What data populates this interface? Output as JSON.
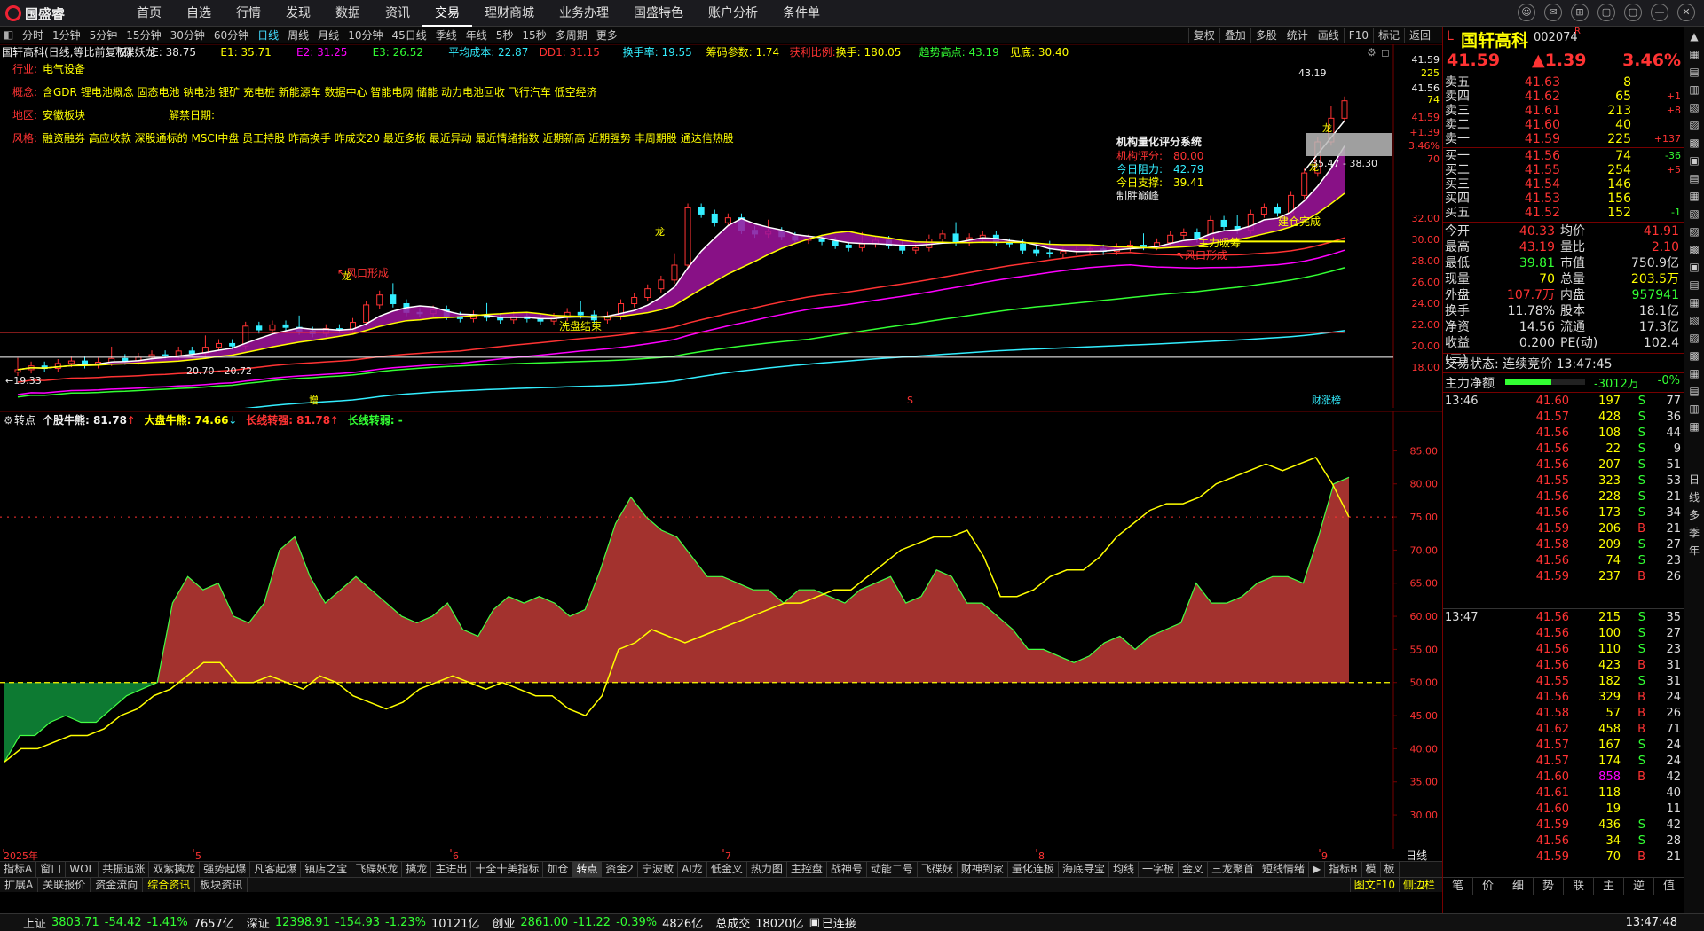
{
  "app": {
    "logo": "国盛睿",
    "menu": [
      "首页",
      "自选",
      "行情",
      "发现",
      "数据",
      "资讯",
      "交易",
      "理财商城",
      "业务办理",
      "国盛特色",
      "账户分析",
      "条件单"
    ],
    "active_menu": "交易",
    "window_controls": [
      "☺",
      "✉",
      "⊞",
      "▢",
      "▢",
      "—",
      "✕"
    ]
  },
  "period": {
    "items": [
      "分时",
      "1分钟",
      "5分钟",
      "15分钟",
      "30分钟",
      "60分钟",
      "日线",
      "周线",
      "月线",
      "10分钟",
      "45日线",
      "季线",
      "年线",
      "5秒",
      "15秒",
      "多周期",
      "更多"
    ],
    "selected": "日线",
    "tools": [
      "复权",
      "叠加",
      "多股",
      "统计",
      "画线",
      "F10",
      "标记",
      "返回"
    ]
  },
  "main": {
    "header": [
      {
        "t": "国轩高科(日线,等比前复权)",
        "c": "#eee"
      },
      {
        "t": "飞碟妖龙",
        "c": "#eee"
      },
      {
        "t": "E: 38.75",
        "c": "#eee"
      },
      {
        "t": "E1: 35.71",
        "c": "#ff0"
      },
      {
        "t": "E2: 31.25",
        "c": "#f0f"
      },
      {
        "t": "E3: 26.52",
        "c": "#3f3"
      },
      {
        "t": "平均成本: 22.87",
        "c": "#3ef"
      },
      {
        "t": "DD1: 31.15",
        "c": "#f33"
      },
      {
        "t": "换手率: 19.55",
        "c": "#3ef"
      },
      {
        "t": "筹码参数: 1.74",
        "c": "#ff0"
      },
      {
        "t": "获利比例:",
        "c": "#f33"
      },
      {
        "t": "换手: 180.05",
        "c": "#ff0"
      },
      {
        "t": "趋势高点: 43.19",
        "c": "#3f3"
      },
      {
        "t": "见底: 30.40",
        "c": "#ff0"
      }
    ],
    "info": [
      {
        "label": "行业:",
        "text": "电气设备"
      },
      {
        "label": "概念:",
        "text": "含GDR 锂电池概念 固态电池 钠电池 锂矿 充电桩 新能源车 数据中心 智能电网 储能 动力电池回收 飞行汽车 低空经济"
      },
      {
        "label": "地区:",
        "text": "安徽板块",
        "extra_label": "解禁日期:",
        "extra_text": ""
      },
      {
        "label": "风格:",
        "text": "融资融券 高应收款 深股通标的 MSCI中盘 员工持股 昨高换手 昨成交20 最近多板 最近异动 最近情绪指数 近期新高 近期强势 丰周期股 通达信热股"
      }
    ],
    "score": {
      "title": "机构量化评分系统",
      "rows": [
        {
          "k": "机构评分:",
          "v": "80.00",
          "c": "#f33"
        },
        {
          "k": "今日阻力:",
          "v": "42.79",
          "c": "#3ef"
        },
        {
          "k": "今日支撑:",
          "v": "39.41",
          "c": "#ff0"
        }
      ],
      "note": "制胜巅峰"
    },
    "labels": {
      "feng1": "风口形成",
      "xipan": "洗盘结束",
      "feng2": "风口形成",
      "zhuli": "主力吸筹",
      "jiancang": "建仓完成",
      "long": "龙",
      "zeng": "增",
      "s": "S",
      "caifu": "财涨榜"
    },
    "price_marks": {
      "high": "43.19",
      "low_pair": "35.47 - 38.30",
      "left_low": "19.33",
      "pair": "20.70 - 20.72"
    },
    "yaxis": [
      "41.59",
      "225",
      "41.56",
      "74",
      "41.59",
      "+1.39",
      "3.46%",
      "70",
      "32.00",
      "30.00",
      "28.00",
      "26.00",
      "24.00",
      "22.00",
      "20.00",
      "18.00"
    ]
  },
  "ind": {
    "title": "转点",
    "items": [
      {
        "t": "个股牛熊: 81.78",
        "c": "#eee",
        "arrow": "↑",
        "ac": "#f33"
      },
      {
        "t": "大盘牛熊: 74.66",
        "c": "#ff0",
        "arrow": "↓",
        "ac": "#3ef"
      },
      {
        "t": "长线转强: 81.78",
        "c": "#f33",
        "arrow": "↑",
        "ac": "#f33"
      },
      {
        "t": "长线转弱: -",
        "c": "#3f3",
        "arrow": "",
        "ac": "#3f3"
      }
    ],
    "yaxis": [
      "85.00",
      "80.00",
      "75.00",
      "70.00",
      "65.00",
      "60.00",
      "55.00",
      "50.00",
      "45.00",
      "40.00",
      "35.00",
      "30.00"
    ]
  },
  "xaxis": {
    "labels": [
      "2025年",
      "5",
      "6",
      "7",
      "8",
      "9"
    ],
    "corner": "日线"
  },
  "chart_data": {
    "type": "area",
    "title": "转点",
    "ylim": [
      25,
      88
    ],
    "series": [
      {
        "name": "个股牛熊",
        "values": [
          38,
          42,
          42,
          44,
          45,
          44,
          44,
          46,
          48,
          49,
          50,
          62,
          66,
          64,
          65,
          60,
          59,
          62,
          70,
          72,
          66,
          62,
          64,
          66,
          64,
          62,
          60,
          59,
          60,
          62,
          58,
          57,
          61,
          63,
          62,
          63,
          62,
          60,
          61,
          67,
          74,
          78,
          75,
          73,
          72,
          69,
          66,
          66,
          65,
          64,
          64,
          62,
          64,
          64,
          63,
          62,
          64,
          65,
          66,
          62,
          63,
          67,
          66,
          62,
          62,
          60,
          58,
          55,
          55,
          54,
          53,
          54,
          56,
          57,
          55,
          57,
          58,
          59,
          65,
          62,
          62,
          63,
          65,
          66,
          66,
          65,
          72,
          80,
          81
        ]
      },
      {
        "name": "大盘牛熊",
        "values": [
          38,
          40,
          40,
          41,
          42,
          42,
          43,
          45,
          46,
          48,
          49,
          51,
          53,
          53,
          50,
          50,
          51,
          50,
          49,
          51,
          50,
          48,
          47,
          46,
          47,
          49,
          50,
          51,
          50,
          49,
          50,
          49,
          48,
          48,
          46,
          45,
          48,
          55,
          56,
          58,
          57,
          56,
          57,
          58,
          59,
          60,
          61,
          62,
          62,
          63,
          64,
          64,
          66,
          68,
          70,
          71,
          72,
          72,
          73,
          69,
          63,
          63,
          64,
          66,
          67,
          67,
          69,
          72,
          74,
          76,
          77,
          77,
          78,
          80,
          81,
          82,
          83,
          82,
          83,
          84,
          80,
          75
        ]
      }
    ]
  },
  "right": {
    "name": "国轩高科",
    "code": "002074",
    "badge": "R",
    "price": "41.59",
    "chg": "1.39",
    "pct": "3.46%",
    "asks": [
      {
        "l": "卖五",
        "p": "41.63",
        "v": "8",
        "c": ""
      },
      {
        "l": "卖四",
        "p": "41.62",
        "v": "65",
        "c": "+1"
      },
      {
        "l": "卖三",
        "p": "41.61",
        "v": "213",
        "c": "+8"
      },
      {
        "l": "卖二",
        "p": "41.60",
        "v": "40",
        "c": ""
      },
      {
        "l": "卖一",
        "p": "41.59",
        "v": "225",
        "c": "+137"
      }
    ],
    "bids": [
      {
        "l": "买一",
        "p": "41.56",
        "v": "74",
        "c": "-36"
      },
      {
        "l": "买二",
        "p": "41.55",
        "v": "254",
        "c": "+5"
      },
      {
        "l": "买三",
        "p": "41.54",
        "v": "146",
        "c": ""
      },
      {
        "l": "买四",
        "p": "41.53",
        "v": "156",
        "c": ""
      },
      {
        "l": "买五",
        "p": "41.52",
        "v": "152",
        "c": "-1"
      }
    ],
    "stats": [
      {
        "a": "今开",
        "b": "40.33",
        "bc": "#f33",
        "c": "均价",
        "d": "41.91",
        "dc": "#f33"
      },
      {
        "a": "最高",
        "b": "43.19",
        "bc": "#f33",
        "c": "量比",
        "d": "2.10",
        "dc": "#f33"
      },
      {
        "a": "最低",
        "b": "39.81",
        "bc": "#3f3",
        "c": "市值",
        "d": "750.9亿",
        "dc": "#ddd"
      },
      {
        "a": "现量",
        "b": "70",
        "bc": "#ff0",
        "c": "总量",
        "d": "203.5万",
        "dc": "#ff0"
      },
      {
        "a": "外盘",
        "b": "107.7万",
        "bc": "#f33",
        "c": "内盘",
        "d": "957941",
        "dc": "#3f3"
      },
      {
        "a": "换手",
        "b": "11.78%",
        "bc": "#ddd",
        "c": "股本",
        "d": "18.1亿",
        "dc": "#ddd"
      },
      {
        "a": "净资",
        "b": "14.56",
        "bc": "#ddd",
        "c": "流通",
        "d": "17.3亿",
        "dc": "#ddd"
      },
      {
        "a": "收益(三)",
        "b": "0.200",
        "bc": "#ddd",
        "c": "PE(动)",
        "d": "102.4",
        "dc": "#ddd"
      }
    ],
    "trade_status": "交易状态: 连续竞价 13:47:45",
    "net_label": "主力净额",
    "net_value": "-3012万",
    "net_pct": "-0%",
    "net_fill": 0.58,
    "ticks1_time": "13:46",
    "ticks2_time": "13:47",
    "ticks1": [
      [
        "41.60",
        "197",
        "S",
        "77"
      ],
      [
        "41.57",
        "428",
        "S",
        "36"
      ],
      [
        "41.56",
        "108",
        "S",
        "44"
      ],
      [
        "41.56",
        "22",
        "S",
        "9"
      ],
      [
        "41.56",
        "207",
        "S",
        "51"
      ],
      [
        "41.55",
        "323",
        "S",
        "53"
      ],
      [
        "41.56",
        "228",
        "S",
        "21"
      ],
      [
        "41.56",
        "173",
        "S",
        "34"
      ],
      [
        "41.59",
        "206",
        "B",
        "21"
      ],
      [
        "41.58",
        "209",
        "S",
        "27"
      ],
      [
        "41.56",
        "74",
        "S",
        "23"
      ],
      [
        "41.59",
        "237",
        "B",
        "26"
      ]
    ],
    "ticks2": [
      [
        "41.56",
        "215",
        "S",
        "35"
      ],
      [
        "41.56",
        "100",
        "S",
        "27"
      ],
      [
        "41.56",
        "110",
        "S",
        "23"
      ],
      [
        "41.56",
        "423",
        "B",
        "31"
      ],
      [
        "41.55",
        "182",
        "S",
        "31"
      ],
      [
        "41.56",
        "329",
        "B",
        "24"
      ],
      [
        "41.58",
        "57",
        "B",
        "26"
      ],
      [
        "41.62",
        "458",
        "B",
        "71"
      ],
      [
        "41.57",
        "167",
        "S",
        "24"
      ],
      [
        "41.57",
        "174",
        "S",
        "24"
      ],
      [
        "41.60",
        "858",
        "B",
        "42"
      ],
      [
        "41.61",
        "118",
        "",
        "40"
      ],
      [
        "41.60",
        "19",
        "",
        "11"
      ],
      [
        "41.59",
        "436",
        "S",
        "42"
      ],
      [
        "41.56",
        "34",
        "S",
        "28"
      ],
      [
        "41.59",
        "70",
        "B",
        "21"
      ]
    ],
    "bottom_tabs": [
      "笔",
      "价",
      "细",
      "势",
      "联",
      "主",
      "逆",
      "值"
    ]
  },
  "side": [
    "日",
    "线",
    "多",
    "季",
    "年"
  ],
  "bottom": {
    "tabs": [
      "指标A",
      "窗口",
      "WOL",
      "共振追涨",
      "双紫擒龙",
      "强势起爆",
      "凡客起爆",
      "镇店之宝",
      "飞碟妖龙",
      "擒龙",
      "主进出",
      "十全十美指标",
      "加仓",
      "转点",
      "资金2",
      "宁波敢",
      "AI龙",
      "低金叉",
      "热力图",
      "主控盘",
      "战神号",
      "动能二号",
      "飞碟妖",
      "财神到家",
      "量化连板",
      "海底寻宝",
      "均线",
      "一字板",
      "金叉",
      "三龙聚首",
      "短线情绪",
      "▶",
      "指标B",
      "模",
      "板"
    ],
    "selected": "转点",
    "tabs2": [
      "扩展A",
      "关联报价",
      "资金流向",
      "综合资讯",
      "板块资讯"
    ],
    "selected2": "综合资讯",
    "right_tabs": [
      "图文F10",
      "侧边栏"
    ]
  },
  "status": {
    "sh_label": "上证",
    "sh": "3803.71",
    "sh_chg": "-54.42",
    "sh_pct": "-1.41%",
    "sh_amt": "7657亿",
    "sz_label": "深证",
    "sz": "12398.91",
    "sz_chg": "-154.93",
    "sz_pct": "-1.23%",
    "sz_amt": "10121亿",
    "cy_label": "创业",
    "cy": "2861.00",
    "cy_chg": "-11.22",
    "cy_pct": "-0.39%",
    "cy_amt": "4826亿",
    "total_label": "总成交",
    "total": "18020亿",
    "conn": "已连接",
    "time": "13:47:48"
  }
}
